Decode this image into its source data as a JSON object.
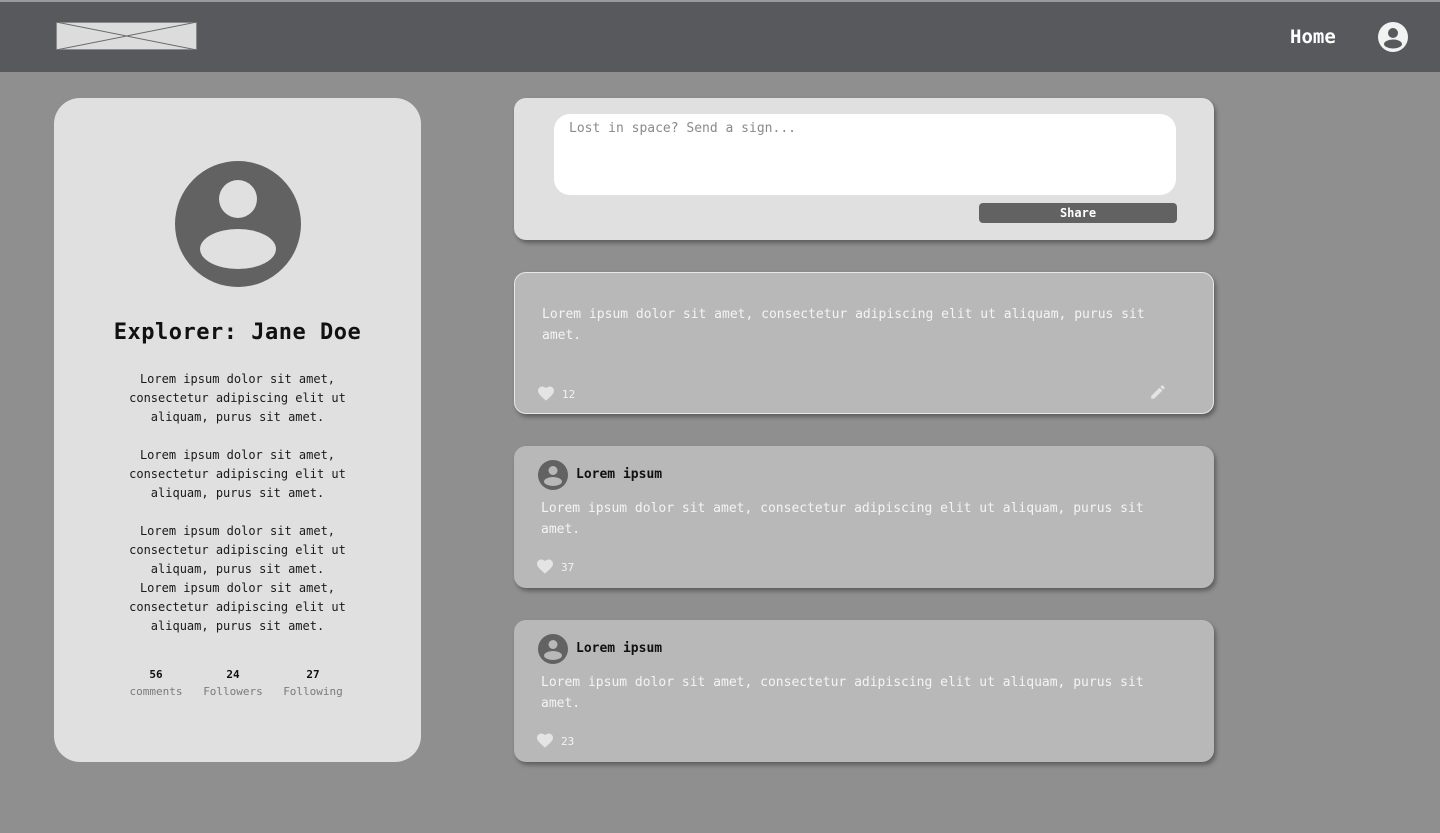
{
  "header": {
    "logo": "logo-placeholder-icon",
    "nav_home": "Home",
    "avatar_icon": "user-account-icon"
  },
  "profile": {
    "name": "Explorer: Jane Doe",
    "bio": [
      "Lorem ipsum dolor sit amet, consectetur adipiscing elit ut aliquam, purus sit amet.",
      "Lorem ipsum dolor sit amet, consectetur adipiscing elit ut aliquam, purus sit amet.",
      "Lorem ipsum dolor sit amet, consectetur adipiscing elit ut aliquam, purus sit amet.",
      "Lorem ipsum dolor sit amet, consectetur adipiscing elit ut aliquam, purus sit amet."
    ],
    "stats": [
      {
        "value": "56",
        "label": "comments"
      },
      {
        "value": "24",
        "label": "Followers"
      },
      {
        "value": "27",
        "label": "Following"
      }
    ]
  },
  "composer": {
    "placeholder": "Lost in space? Send a sign...",
    "value": "",
    "share_label": "Share"
  },
  "posts": [
    {
      "author": "",
      "text": "Lorem ipsum dolor sit amet, consectetur adipiscing elit ut aliquam, purus sit amet.",
      "likes": "12",
      "editable": true
    },
    {
      "author": "Lorem ipsum",
      "text": "Lorem ipsum dolor sit amet, consectetur adipiscing elit ut aliquam, purus sit amet.",
      "likes": "37",
      "editable": false
    },
    {
      "author": "Lorem ipsum",
      "text": "Lorem ipsum dolor sit amet, consectetur adipiscing elit ut aliquam, purus sit amet.",
      "likes": "23",
      "editable": false
    }
  ],
  "colors": {
    "page_bg": "#8f8f8f",
    "topbar": "#58595d",
    "card_light": "#e0e0e0",
    "post_bg": "#b8b8b8",
    "button": "#626262",
    "avatar": "#626262"
  },
  "icons": {
    "like": "heart-icon",
    "edit": "pencil-icon",
    "avatar": "user-avatar-icon"
  }
}
